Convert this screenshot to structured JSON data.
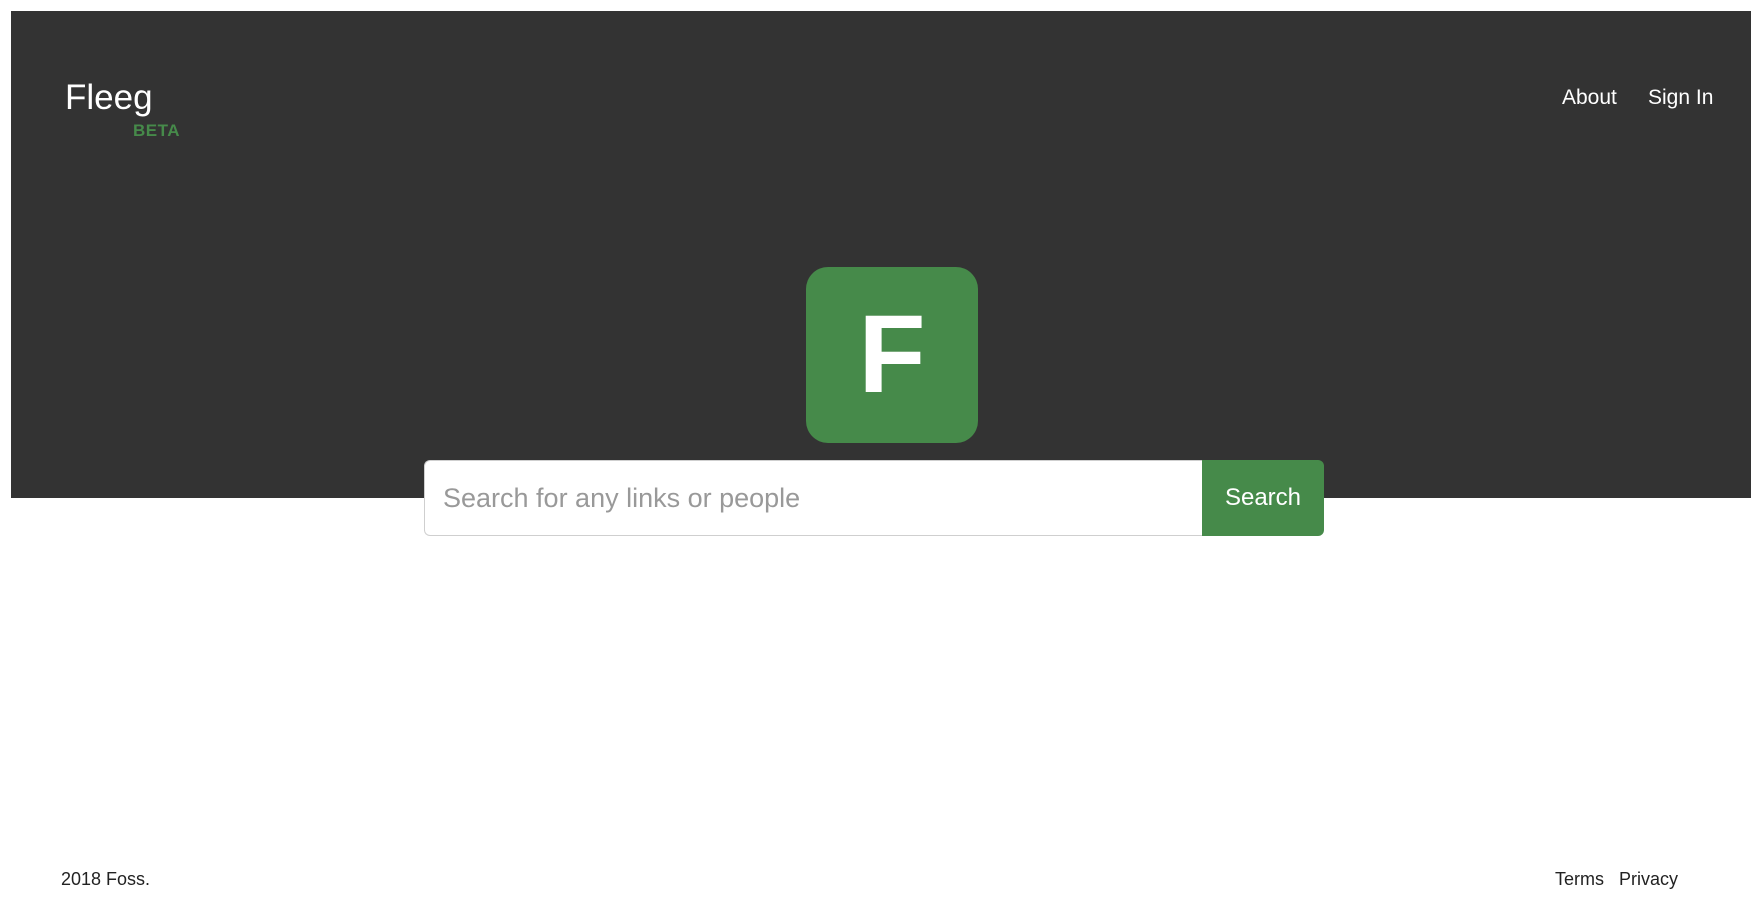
{
  "header": {
    "brand": "Fleeg",
    "badge": "BETA",
    "nav": {
      "about": "About",
      "sign_in": "Sign In"
    }
  },
  "hero": {
    "logo_letter": "F"
  },
  "search": {
    "placeholder": "Search for any links or people",
    "value": "",
    "button_label": "Search"
  },
  "footer": {
    "copyright": "2018 Foss.",
    "terms": "Terms",
    "privacy": "Privacy"
  },
  "colors": {
    "hero_background": "#333333",
    "accent": "#468a4a",
    "page_background": "#ffffff"
  }
}
